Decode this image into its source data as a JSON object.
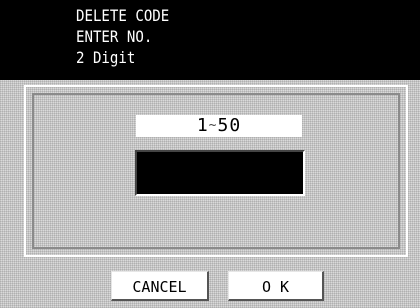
{
  "header": {
    "line1": "DELETE CODE",
    "line2": "ENTER NO.",
    "line3": "2 Digit"
  },
  "dialog": {
    "range_start": "1",
    "range_sep": "~",
    "range_end": "50",
    "input_value": ""
  },
  "buttons": {
    "cancel": "CANCEL",
    "ok": "O K"
  },
  "colors": {
    "header_bg": "#000000",
    "header_text": "#ffffff",
    "panel_bg": "#dadada",
    "input_bg": "#000000"
  }
}
